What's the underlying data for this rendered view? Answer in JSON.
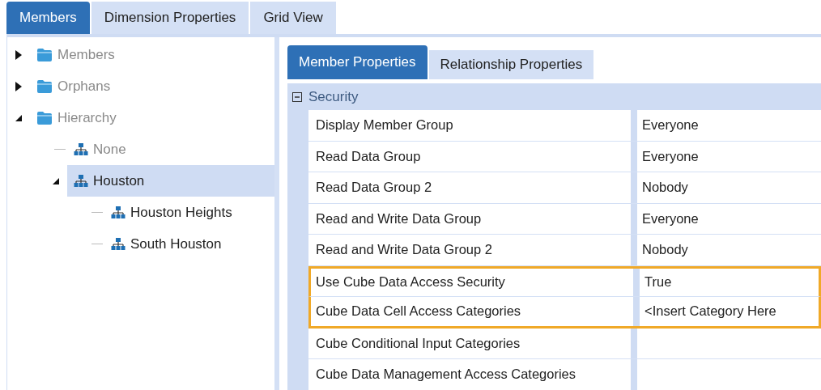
{
  "tabs": [
    {
      "label": "Members",
      "selected": true
    },
    {
      "label": "Dimension Properties",
      "selected": false
    },
    {
      "label": "Grid View",
      "selected": false
    }
  ],
  "tree": [
    {
      "label": "Members",
      "kind": "folder",
      "expanded": false,
      "selected": false,
      "dimmed": true
    },
    {
      "label": "Orphans",
      "kind": "folder",
      "expanded": false,
      "selected": false,
      "dimmed": true
    },
    {
      "label": "Hierarchy",
      "kind": "folder",
      "expanded": true,
      "selected": false,
      "dimmed": true,
      "children": [
        {
          "label": "None",
          "kind": "member",
          "selected": false,
          "dimmed": true
        },
        {
          "label": "Houston",
          "kind": "member",
          "expanded": true,
          "selected": true,
          "dimmed": false,
          "children": [
            {
              "label": "Houston Heights",
              "kind": "member",
              "selected": false,
              "dimmed": false
            },
            {
              "label": "South Houston",
              "kind": "member",
              "selected": false,
              "dimmed": false
            }
          ]
        }
      ]
    }
  ],
  "property_tabs": [
    {
      "label": "Member Properties",
      "selected": true
    },
    {
      "label": "Relationship Properties",
      "selected": false
    }
  ],
  "category": {
    "label": "Security",
    "expanded": true
  },
  "properties": [
    {
      "name": "Display Member Group",
      "value": "Everyone",
      "highlighted": false
    },
    {
      "name": "Read Data Group",
      "value": "Everyone",
      "highlighted": false
    },
    {
      "name": "Read Data Group 2",
      "value": "Nobody",
      "highlighted": false
    },
    {
      "name": "Read and Write Data Group",
      "value": "Everyone",
      "highlighted": false
    },
    {
      "name": "Read and Write Data Group 2",
      "value": "Nobody",
      "highlighted": false
    },
    {
      "name": "Use Cube Data Access Security",
      "value": "True",
      "highlighted": true
    },
    {
      "name": "Cube Data Cell Access Categories",
      "value": "<Insert Category Here",
      "highlighted": true
    },
    {
      "name": "Cube Conditional Input Categories",
      "highlighted": false
    },
    {
      "name": "Cube Data Management Access Categories",
      "highlighted": false
    }
  ]
}
